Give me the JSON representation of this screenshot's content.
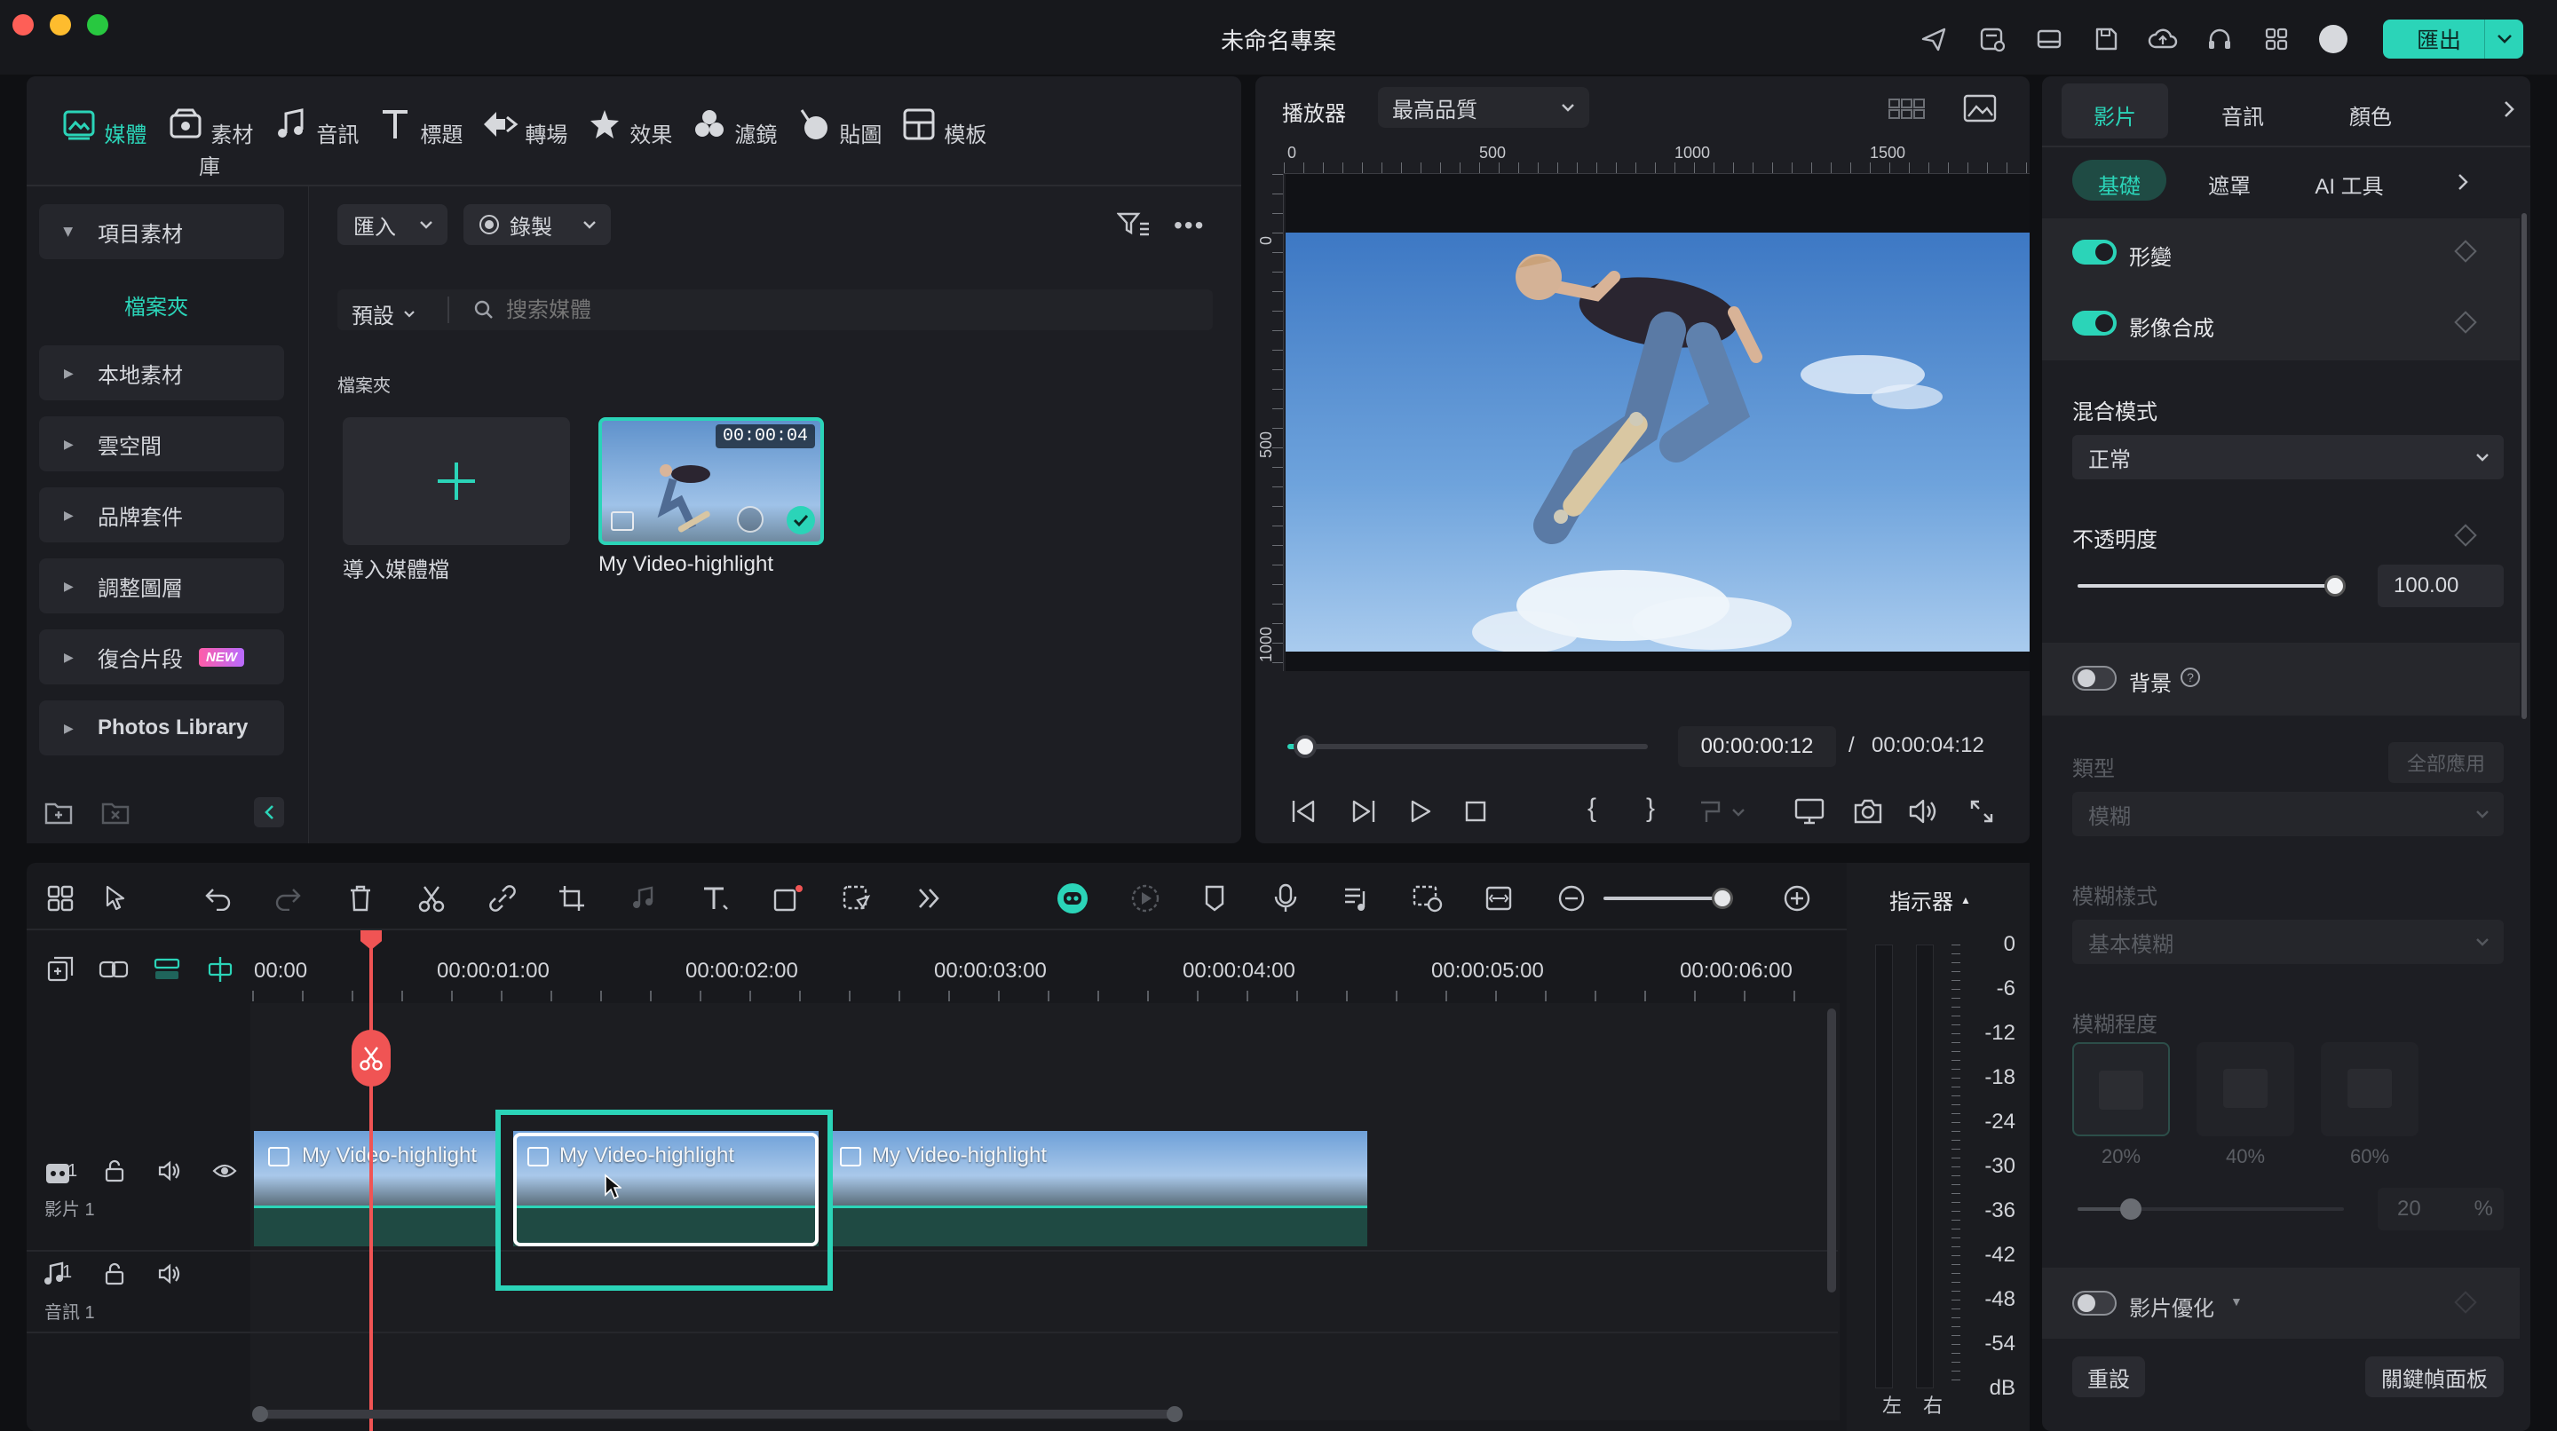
{
  "window": {
    "title": "未命名專案",
    "export_label": "匯出"
  },
  "media_tabs": [
    {
      "label": "媒體",
      "icon": "media-icon",
      "active": true
    },
    {
      "label": "素材庫",
      "icon": "stock-icon"
    },
    {
      "label": "音訊",
      "icon": "music-icon"
    },
    {
      "label": "標題",
      "icon": "title-icon"
    },
    {
      "label": "轉場",
      "icon": "transition-icon"
    },
    {
      "label": "效果",
      "icon": "effects-icon"
    },
    {
      "label": "濾鏡",
      "icon": "filter-icon"
    },
    {
      "label": "貼圖",
      "icon": "sticker-icon"
    },
    {
      "label": "模板",
      "icon": "template-icon"
    }
  ],
  "sidebar": {
    "project_media": "項目素材",
    "folder": "檔案夾",
    "items": [
      "本地素材",
      "雲空間",
      "品牌套件",
      "調整圖層",
      "復合片段",
      "Photos Library"
    ],
    "new_badge": "NEW"
  },
  "media": {
    "import_label": "匯入",
    "record_label": "錄製",
    "preset_label": "預設",
    "search_placeholder": "搜索媒體",
    "folder_heading": "檔案夾",
    "import_tile_label": "導入媒體檔",
    "clip_name": "My Video-highlight",
    "clip_duration": "00:00:04"
  },
  "player": {
    "label": "播放器",
    "quality": "最高品質",
    "ruler_h": [
      "0",
      "500",
      "1000",
      "1500"
    ],
    "ruler_v": [
      "0",
      "500",
      "1000"
    ],
    "progress": 0.05,
    "current_time": "00:00:00:12",
    "separator": "/",
    "total_time": "00:00:04:12",
    "mark_in": "{",
    "mark_out": "}"
  },
  "props": {
    "tabs": [
      "影片",
      "音訊",
      "顏色"
    ],
    "subtabs": [
      "基礎",
      "遮罩",
      "AI 工具"
    ],
    "transform": "形變",
    "compositing": "影像合成",
    "blend_mode_label": "混合模式",
    "blend_mode_value": "正常",
    "opacity_label": "不透明度",
    "opacity_value": "100.00",
    "opacity_level": 1.0,
    "background_label": "背景",
    "type_label": "類型",
    "apply_all": "全部應用",
    "type_value": "模糊",
    "blur_style_label": "模糊樣式",
    "blur_style_value": "基本模糊",
    "blur_level_label": "模糊程度",
    "blur_presets": [
      "20%",
      "40%",
      "60%"
    ],
    "blur_value": "20",
    "blur_unit": "%",
    "blur_level": 0.2,
    "enhance_label": "影片優化",
    "reset_label": "重設",
    "keyframe_label": "關鍵幀面板"
  },
  "timeline": {
    "ruler_labels": [
      "00:00",
      "00:00:01:00",
      "00:00:02:00",
      "00:00:03:00",
      "00:00:04:00",
      "00:00:05:00",
      "00:00:06:00"
    ],
    "video_track_label": "影片 1",
    "video_track_num": "1",
    "audio_track_label": "音訊 1",
    "audio_track_num": "1",
    "clips": [
      "My Video-highlight",
      "My Video-highlight",
      "My Video-highlight"
    ],
    "meter_label": "指示器",
    "meter_scale": [
      "0",
      "-6",
      "-12",
      "-18",
      "-24",
      "-30",
      "-36",
      "-42",
      "-48",
      "-54",
      "dB"
    ],
    "meter_left": "左",
    "meter_right": "右"
  },
  "colors": {
    "accent": "#2bd4b8",
    "playhead": "#f05454",
    "background": "#0f1013"
  }
}
